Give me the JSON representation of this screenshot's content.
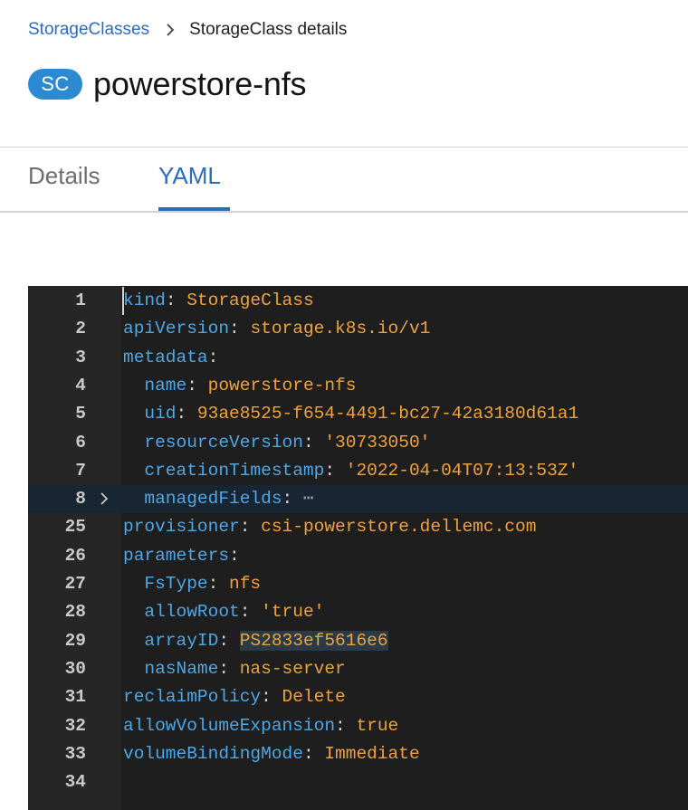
{
  "breadcrumb": {
    "parent": "StorageClasses",
    "current": "StorageClass details"
  },
  "header": {
    "badge": "SC",
    "title": "powerstore-nfs"
  },
  "tabs": [
    {
      "label": "Details",
      "active": false
    },
    {
      "label": "YAML",
      "active": true
    }
  ],
  "colors": {
    "link": "#2b6cbf",
    "badge": "#2b8ad1",
    "editor_bg": "#1e1e1e",
    "yaml_key": "#4ea7e6",
    "yaml_value": "#f0a23a"
  },
  "editor": {
    "lines": [
      {
        "num": "1",
        "indent": "",
        "key": "kind",
        "value": "StorageClass"
      },
      {
        "num": "2",
        "indent": "",
        "key": "apiVersion",
        "value": "storage.k8s.io/v1"
      },
      {
        "num": "3",
        "indent": "",
        "key": "metadata",
        "value": ""
      },
      {
        "num": "4",
        "indent": "  ",
        "key": "name",
        "value": "powerstore-nfs"
      },
      {
        "num": "5",
        "indent": "  ",
        "key": "uid",
        "value": "93ae8525-f654-4491-bc27-42a3180d61a1"
      },
      {
        "num": "6",
        "indent": "  ",
        "key": "resourceVersion",
        "value": "'30733050'"
      },
      {
        "num": "7",
        "indent": "  ",
        "key": "creationTimestamp",
        "value": "'2022-04-04T07:13:53Z'"
      },
      {
        "num": "8",
        "indent": "  ",
        "key": "managedFields",
        "value": "",
        "folded": true,
        "ellipsis": "⋯"
      },
      {
        "num": "25",
        "indent": "",
        "key": "provisioner",
        "value": "csi-powerstore.dellemc.com"
      },
      {
        "num": "26",
        "indent": "",
        "key": "parameters",
        "value": ""
      },
      {
        "num": "27",
        "indent": "  ",
        "key": "FsType",
        "value": "nfs"
      },
      {
        "num": "28",
        "indent": "  ",
        "key": "allowRoot",
        "value": "'true'"
      },
      {
        "num": "29",
        "indent": "  ",
        "key": "arrayID",
        "value": "PS2833ef5616e6"
      },
      {
        "num": "30",
        "indent": "  ",
        "key": "nasName",
        "value": "nas-server"
      },
      {
        "num": "31",
        "indent": "",
        "key": "reclaimPolicy",
        "value": "Delete"
      },
      {
        "num": "32",
        "indent": "",
        "key": "allowVolumeExpansion",
        "value": "true"
      },
      {
        "num": "33",
        "indent": "",
        "key": "volumeBindingMode",
        "value": "Immediate"
      },
      {
        "num": "34",
        "indent": "",
        "key": "",
        "value": ""
      }
    ]
  }
}
